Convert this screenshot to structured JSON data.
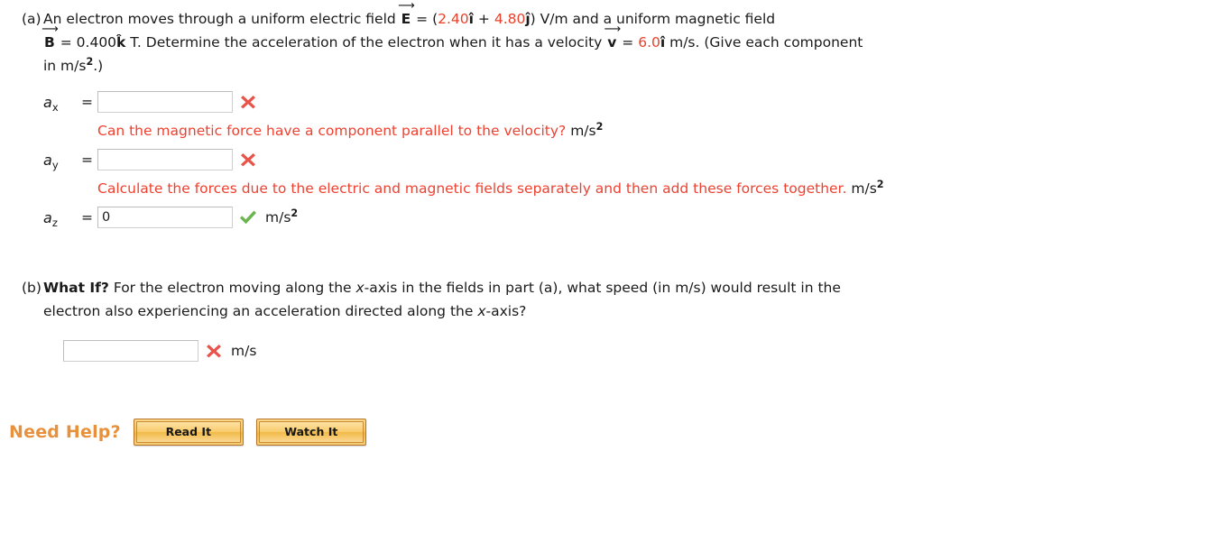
{
  "parts": [
    {
      "label": "(a)",
      "statement_pre_E": "An electron moves through a uniform electric field ",
      "E_symbol": "E",
      "eq1": " = (",
      "E_x_value": "2.40",
      "E_x_unit": "î",
      "E_plus": " + ",
      "E_y_value": "4.80",
      "E_y_unit": "ĵ",
      "E_close": ") V/m and a uniform magnetic field",
      "B_symbol": "B",
      "B_eq": " = 0.400",
      "B_unit": "k̂",
      "B_tail": " T. Determine the acceleration of the electron when it has a velocity ",
      "v_symbol": "v",
      "v_eq": " = ",
      "v_value": "6.0",
      "v_unit": "î",
      "v_tail": " m/s. (Give each component",
      "line3_pre": "in m/s",
      "line3_exp": "2",
      "line3_post": ".)"
    },
    {
      "label": "(b)",
      "whatif": "What If?",
      "statement_1a": " For the electron moving along the ",
      "axis_x_1": "x",
      "statement_1b": "-axis in the fields in part (a), what speed (in m/s) would result in the",
      "statement_2a": "electron also experiencing an acceleration directed along the ",
      "axis_x_2": "x",
      "statement_2b": "-axis?"
    }
  ],
  "answers": [
    {
      "var": "a",
      "sub": "x",
      "equals": "=",
      "value": "",
      "placeholder": "",
      "status": "incorrect",
      "status_icon": "red-x-icon",
      "unit": "",
      "unit_exp": ""
    },
    {
      "var": "a",
      "sub": "y",
      "equals": "=",
      "value": "",
      "placeholder": "",
      "status": "incorrect",
      "status_icon": "red-x-icon",
      "unit": "",
      "unit_exp": ""
    },
    {
      "var": "a",
      "sub": "z",
      "equals": "=",
      "value": "0",
      "placeholder": "",
      "status": "correct",
      "status_icon": "green-check-icon",
      "unit": "m/s",
      "unit_exp": "2"
    }
  ],
  "feedback": [
    {
      "text": "Can the magnetic force have a component parallel to the velocity?",
      "unit": "m/s",
      "unit_exp": "2"
    },
    {
      "text": "Calculate the forces due to the electric and magnetic fields separately and then add these forces together.",
      "unit": "m/s",
      "unit_exp": "2"
    }
  ],
  "part_b_answer": {
    "value": "",
    "placeholder": "",
    "status": "incorrect",
    "status_icon": "red-x-icon",
    "unit": "m/s"
  },
  "need_help": {
    "label": "Need Help?",
    "buttons": [
      {
        "label": "Read It",
        "name": "read-it-button"
      },
      {
        "label": "Watch It",
        "name": "watch-it-button"
      }
    ]
  },
  "colors": {
    "red_value": "#e8402a",
    "feedback_red": "#ef4130",
    "need_help_orange": "#e8913c",
    "check_green": "#6cb551",
    "x_red": "#e8534a"
  }
}
